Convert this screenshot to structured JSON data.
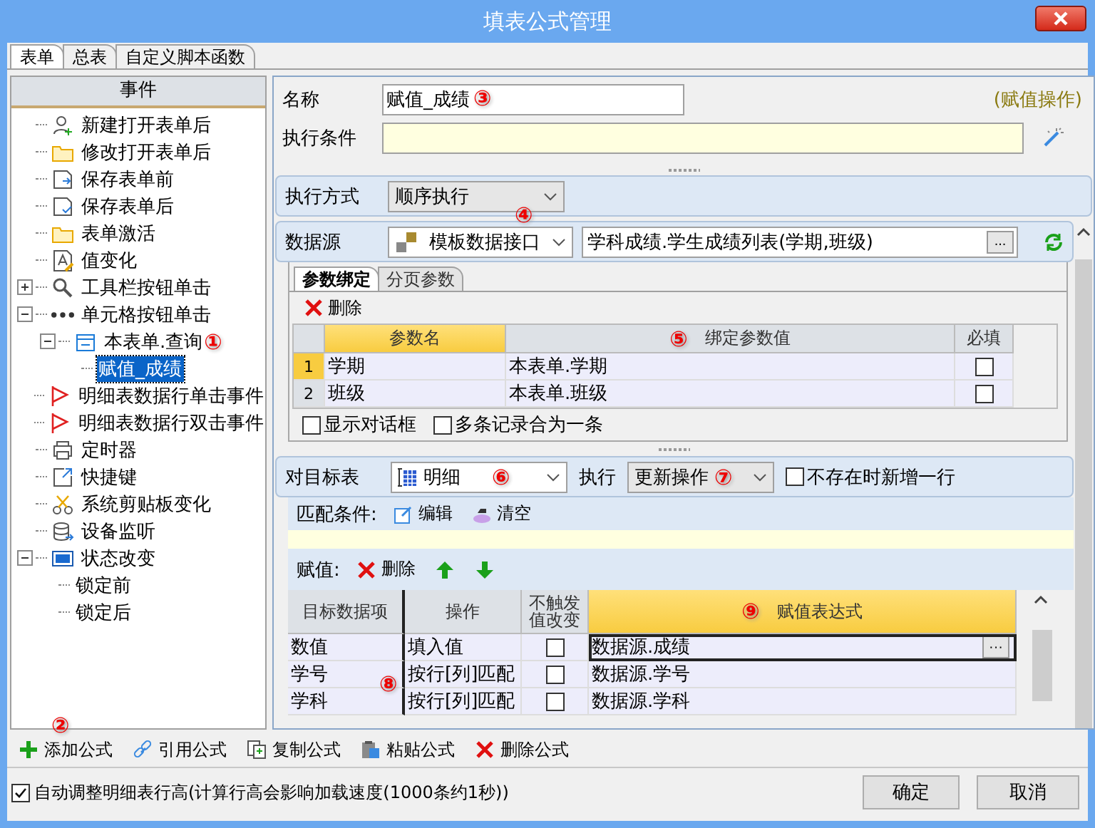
{
  "window": {
    "title": "填表公式管理"
  },
  "tabs": [
    {
      "label": "表单",
      "selected": true
    },
    {
      "label": "总表",
      "selected": false
    },
    {
      "label": "自定义脚本函数",
      "selected": false
    }
  ],
  "events": {
    "header": "事件",
    "tree": [
      {
        "label": "新建打开表单后",
        "kind": "user-add",
        "selected": false
      },
      {
        "label": "修改打开表单后",
        "kind": "folder",
        "selected": false
      },
      {
        "label": "保存表单前",
        "kind": "save-in",
        "selected": false
      },
      {
        "label": "保存表单后",
        "kind": "save-check",
        "selected": false
      },
      {
        "label": "表单激活",
        "kind": "folder",
        "selected": false
      },
      {
        "label": "值变化",
        "kind": "doc-edit",
        "selected": false
      },
      {
        "label": "工具栏按钮单击",
        "kind": "magnifier",
        "selected": false,
        "expanded": false
      },
      {
        "label": "单元格按钮单击",
        "kind": "dots",
        "selected": false,
        "expanded": true,
        "children": [
          {
            "label": "本表单.查询",
            "kind": "form",
            "selected": false,
            "expanded": true,
            "callout": "①",
            "children": [
              {
                "label": "赋值_成绩",
                "selected": true
              }
            ]
          }
        ]
      },
      {
        "label": "明细表数据行单击事件",
        "kind": "flag",
        "selected": false
      },
      {
        "label": "明细表数据行双击事件",
        "kind": "flag",
        "selected": false
      },
      {
        "label": "定时器",
        "kind": "printer",
        "selected": false
      },
      {
        "label": "快捷键",
        "kind": "share",
        "selected": false
      },
      {
        "label": "系统剪贴板变化",
        "kind": "scissors",
        "selected": false
      },
      {
        "label": "设备监听",
        "kind": "database",
        "selected": false
      },
      {
        "label": "状态改变",
        "kind": "xf",
        "selected": false,
        "expanded": true,
        "children": [
          {
            "label": "锁定前",
            "selected": false
          },
          {
            "label": "锁定后",
            "selected": false
          }
        ]
      }
    ]
  },
  "formula": {
    "name": {
      "label": "名称",
      "value": "赋值_成绩",
      "callout": "③"
    },
    "type_note": "(赋值操作)",
    "condition": {
      "label": "执行条件"
    },
    "exec_mode": {
      "label": "执行方式",
      "value": "顺序执行",
      "callout": "④"
    },
    "data_source": {
      "label": "数据源",
      "interface": "模板数据接口",
      "method": "学科成绩.学生成绩列表(学期,班级)",
      "browse_button": "..."
    },
    "param_tabs": [
      {
        "label": "参数绑定",
        "selected": true
      },
      {
        "label": "分页参数",
        "selected": false
      }
    ],
    "param_toolbar": [
      {
        "label": "删除",
        "kind": "delete"
      }
    ],
    "param_grid": {
      "columns": [
        {
          "label": "参数名",
          "selected": true
        },
        {
          "label": "绑定参数值",
          "callout": "⑤",
          "selected": false
        },
        {
          "label": "必填",
          "selected": false
        }
      ],
      "rows": [
        {
          "number": "1",
          "selected": true,
          "name": "学期",
          "value": "本表单.学期",
          "required": false
        },
        {
          "number": "2",
          "selected": false,
          "name": "班级",
          "value": "本表单.班级",
          "required": false
        }
      ]
    },
    "param_options": [
      {
        "label": "显示对话框",
        "checked": false
      },
      {
        "label": "多条记录合为一条",
        "checked": false
      }
    ],
    "target": {
      "label": "对目标表",
      "table": "明细",
      "table_callout": "⑥",
      "action_label": "执行",
      "action": "更新操作",
      "action_callout": "⑦",
      "add_if_missing": {
        "label": "不存在时新增一行",
        "checked": false
      }
    },
    "match": {
      "label": "匹配条件:",
      "tools": [
        {
          "label": "编辑",
          "kind": "edit"
        },
        {
          "label": "清空",
          "kind": "clear"
        }
      ]
    },
    "assign": {
      "label": "赋值:",
      "tools": [
        {
          "label": "删除",
          "kind": "delete"
        },
        {
          "kind": "up"
        },
        {
          "kind": "down"
        }
      ],
      "grid": {
        "callout": "⑧",
        "columns": [
          {
            "label": "目标数据项",
            "selected": false
          },
          {
            "label": "操作",
            "selected": false
          },
          {
            "label": "不触发值改变",
            "selected": false
          },
          {
            "label": "赋值表达式",
            "callout": "⑨",
            "selected": true
          }
        ],
        "rows": [
          {
            "target": "数值",
            "operation": "填入值",
            "no_trigger": false,
            "expression": "数据源.成绩",
            "button": "···",
            "selected": true
          },
          {
            "target": "学号",
            "operation": "按行[列]匹配",
            "no_trigger": false,
            "expression": "数据源.学号",
            "selected": false
          },
          {
            "target": "学科",
            "operation": "按行[列]匹配",
            "no_trigger": false,
            "expression": "数据源.学科",
            "selected": false
          }
        ]
      }
    }
  },
  "toolbar": [
    {
      "label": "添加公式",
      "kind": "add",
      "callout": "②"
    },
    {
      "label": "引用公式",
      "kind": "link"
    },
    {
      "label": "复制公式",
      "kind": "copy"
    },
    {
      "label": "粘贴公式",
      "kind": "paste"
    },
    {
      "label": "删除公式",
      "kind": "delete"
    }
  ],
  "auto_row_height": {
    "label": "自动调整明细表行高(计算行高会影响加载速度(1000条约1秒))",
    "checked": true
  },
  "buttons": [
    {
      "label": "确定"
    },
    {
      "label": "取消"
    }
  ]
}
